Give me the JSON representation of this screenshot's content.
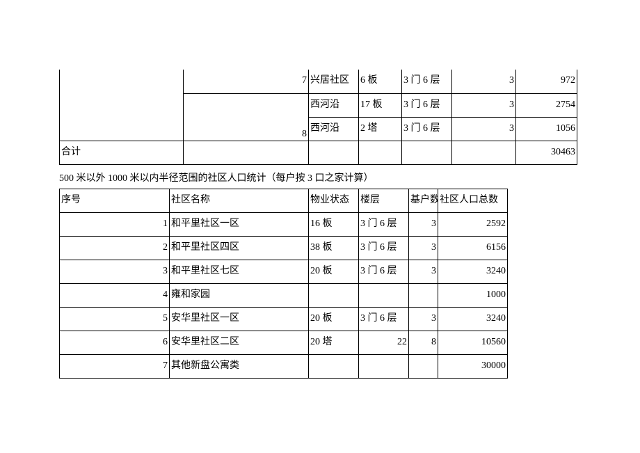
{
  "table1": {
    "rows": [
      {
        "seq": "7",
        "name": "兴居社区",
        "property": "6 板",
        "floors": "3 门 6 层",
        "base": "3",
        "pop": "972"
      },
      {
        "seq": "",
        "name": "西河沿",
        "property": "17 板",
        "floors": "3 门 6 层",
        "base": "3",
        "pop": "2754"
      },
      {
        "seq": "8",
        "name": "西河沿",
        "property": "2 塔",
        "floors": "3 门 6 层",
        "base": "3",
        "pop": "1056"
      }
    ],
    "total_label": "合计",
    "total_value": "30463"
  },
  "caption": "500 米以外 1000 米以内半径范围的社区人口统计（每户按 3 口之家计算）",
  "table2": {
    "headers": {
      "seq": "序号",
      "name": "社区名称",
      "property": "物业状态",
      "floors": "楼层",
      "base": "基户数",
      "pop": "社区人口总数"
    },
    "rows": [
      {
        "seq": "1",
        "name": "和平里社区一区",
        "property": "16 板",
        "floors": "3 门 6 层",
        "base": "3",
        "pop": "2592"
      },
      {
        "seq": "2",
        "name": "和平里社区四区",
        "property": "38 板",
        "floors": "3 门 6 层",
        "base": "3",
        "pop": "6156"
      },
      {
        "seq": "3",
        "name": "和平里社区七区",
        "property": "20 板",
        "floors": "3 门 6 层",
        "base": "3",
        "pop": "3240"
      },
      {
        "seq": "4",
        "name": "雍和家园",
        "property": "",
        "floors": "",
        "base": "",
        "pop": "1000"
      },
      {
        "seq": "5",
        "name": "安华里社区一区",
        "property": "20 板",
        "floors": "3 门 6 层",
        "base": "3",
        "pop": "3240"
      },
      {
        "seq": "6",
        "name": "安华里社区二区",
        "property": "20 塔",
        "floors": "22",
        "base": "8",
        "pop": "10560"
      },
      {
        "seq": "7",
        "name": "其他新盘公寓类",
        "property": "",
        "floors": "",
        "base": "",
        "pop": "30000"
      }
    ]
  },
  "chart_data": [
    {
      "type": "table",
      "title": "上段表格末行（续）",
      "columns": [
        "序号",
        "社区名称",
        "物业状态",
        "楼层",
        "基户数",
        "社区人口总数"
      ],
      "rows": [
        [
          7,
          "兴居社区",
          "6 板",
          "3 门 6 层",
          3,
          972
        ],
        [
          null,
          "西河沿",
          "17 板",
          "3 门 6 层",
          3,
          2754
        ],
        [
          8,
          "西河沿",
          "2 塔",
          "3 门 6 层",
          3,
          1056
        ]
      ],
      "total": {
        "label": "合计",
        "社区人口总数": 30463
      }
    },
    {
      "type": "table",
      "title": "500 米以外 1000 米以内半径范围的社区人口统计（每户按 3 口之家计算）",
      "columns": [
        "序号",
        "社区名称",
        "物业状态",
        "楼层",
        "基户数",
        "社区人口总数"
      ],
      "rows": [
        [
          1,
          "和平里社区一区",
          "16 板",
          "3 门 6 层",
          3,
          2592
        ],
        [
          2,
          "和平里社区四区",
          "38 板",
          "3 门 6 层",
          3,
          6156
        ],
        [
          3,
          "和平里社区七区",
          "20 板",
          "3 门 6 层",
          3,
          3240
        ],
        [
          4,
          "雍和家园",
          "",
          "",
          null,
          1000
        ],
        [
          5,
          "安华里社区一区",
          "20 板",
          "3 门 6 层",
          3,
          3240
        ],
        [
          6,
          "安华里社区二区",
          "20 塔",
          "22",
          8,
          10560
        ],
        [
          7,
          "其他新盘公寓类",
          "",
          "",
          null,
          30000
        ]
      ]
    }
  ]
}
